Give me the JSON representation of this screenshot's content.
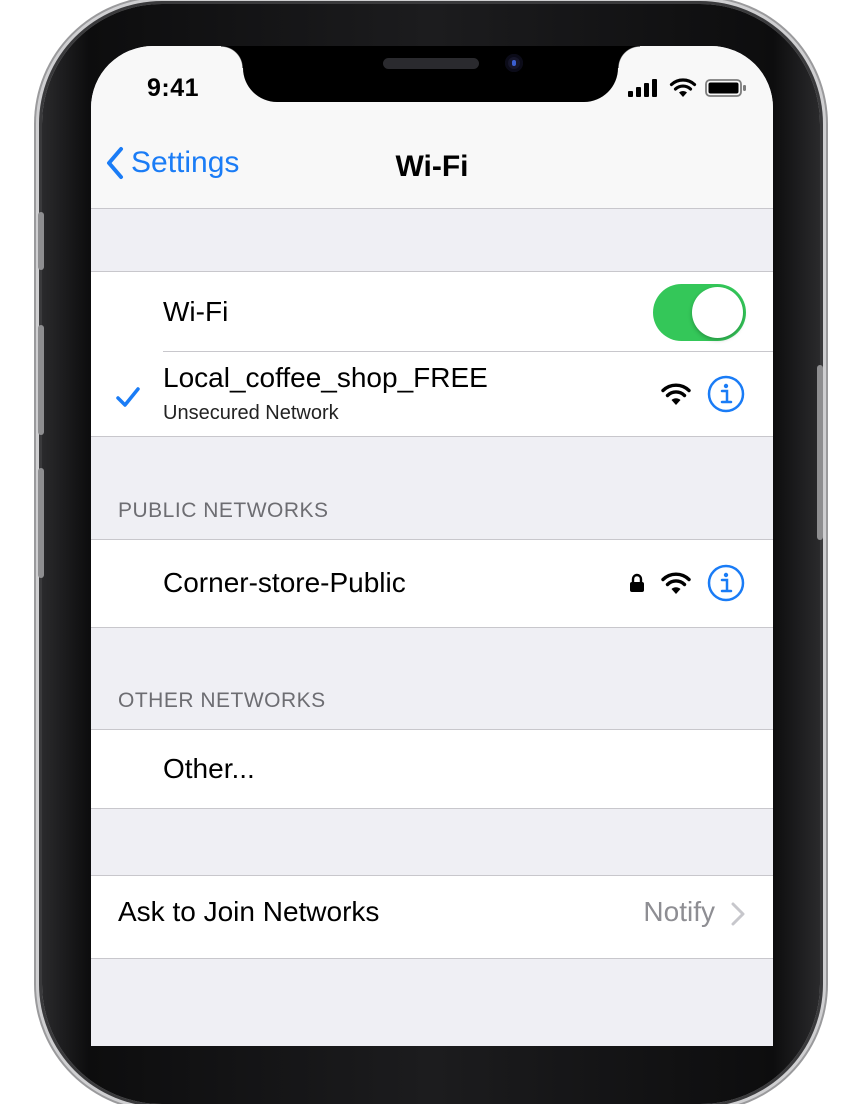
{
  "status_bar": {
    "time": "9:41"
  },
  "nav": {
    "back_label": "Settings",
    "title": "Wi-Fi"
  },
  "wifi_toggle": {
    "label": "Wi-Fi",
    "enabled": true
  },
  "connected_network": {
    "name": "Local_coffee_shop_FREE",
    "subtitle": "Unsecured Network",
    "selected": true
  },
  "public_networks": {
    "header": "PUBLIC NETWORKS",
    "items": [
      {
        "name": "Corner-store-Public",
        "locked": true
      }
    ]
  },
  "other_networks": {
    "header": "OTHER NETWORKS",
    "items": [
      {
        "name": "Other..."
      }
    ]
  },
  "ask_to_join": {
    "label": "Ask to Join Networks",
    "value": "Notify"
  },
  "colors": {
    "accent": "#1a7cf6",
    "toggle_on": "#34c759",
    "background": "#efeff4"
  }
}
